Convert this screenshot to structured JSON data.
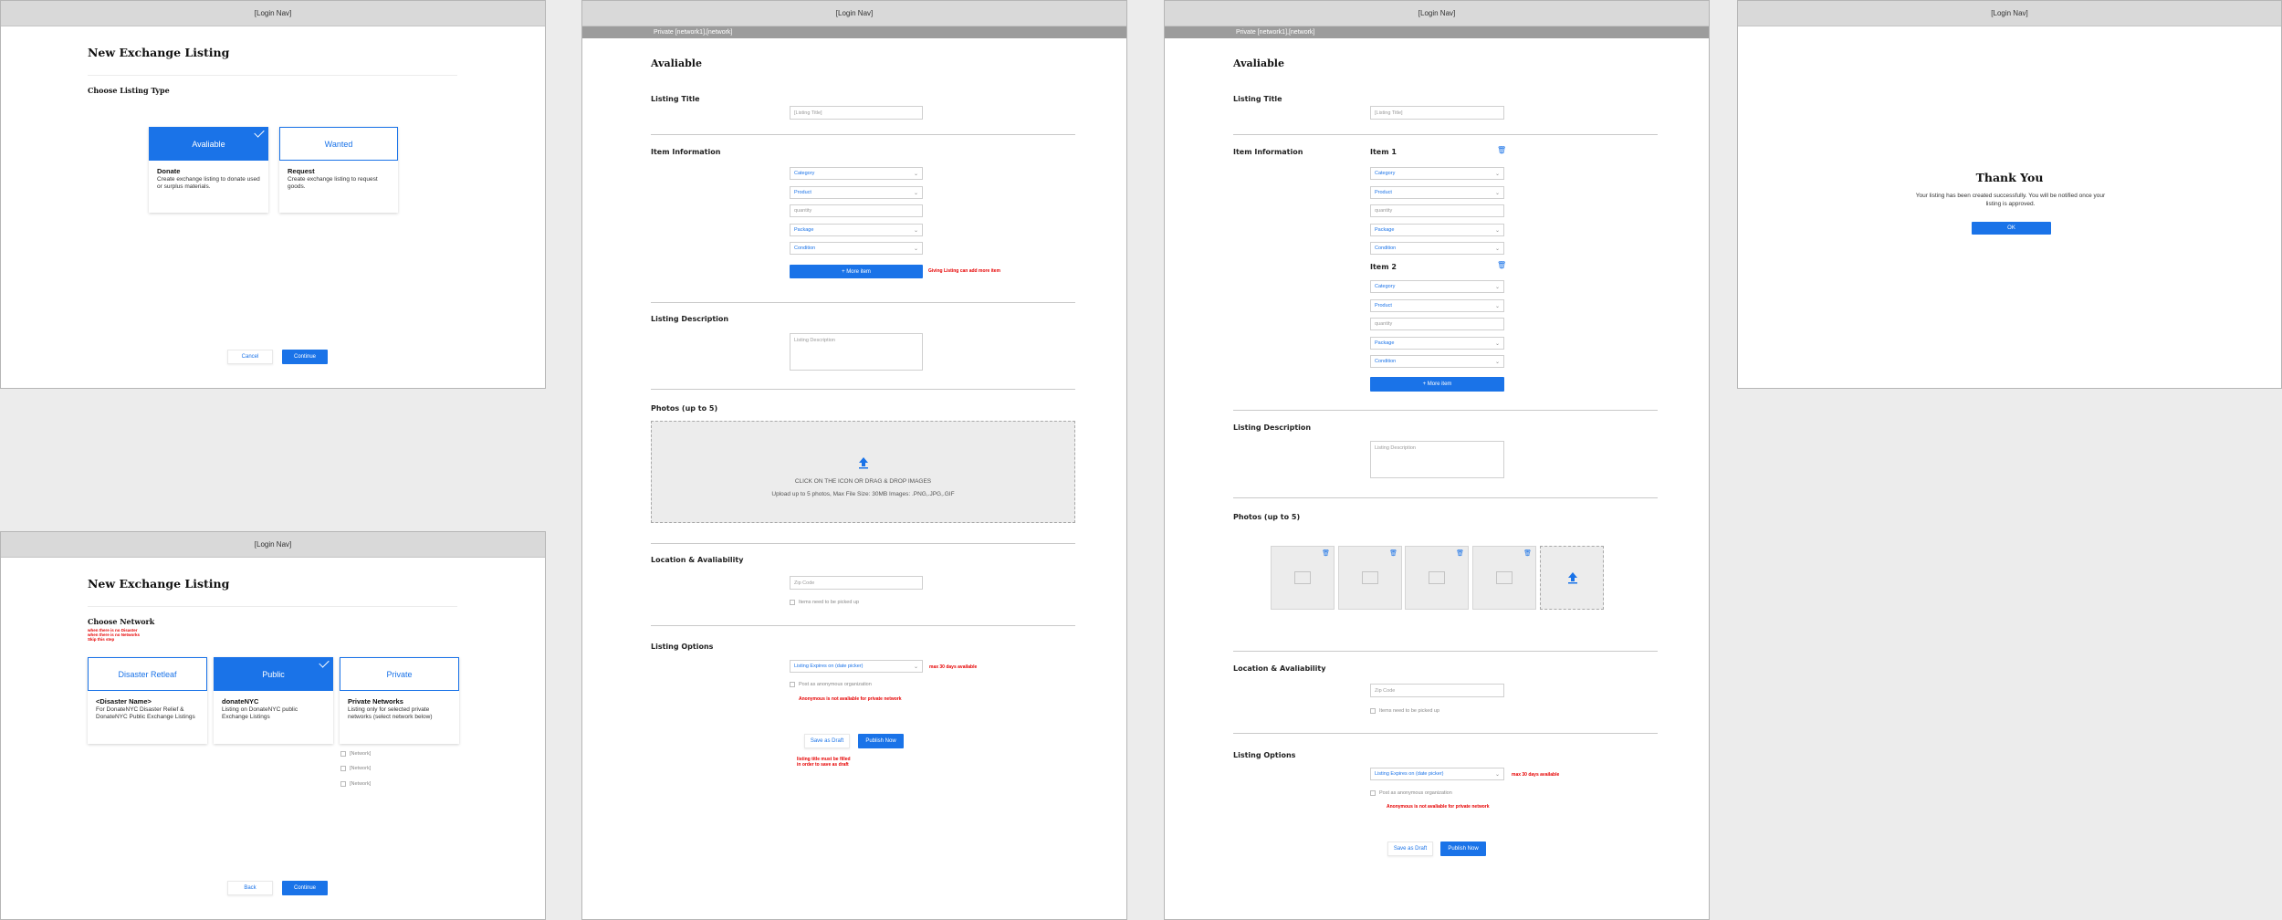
{
  "nav_label": "[Login Nav]",
  "subnav_label": "Private [network1],[network]",
  "f1": {
    "title": "New Exchange Listing",
    "subtitle": "Choose Listing Type",
    "cards": [
      {
        "head": "Avaliable",
        "title": "Donate",
        "desc": "Create exchange listing to donate used or surplus materials."
      },
      {
        "head": "Wanted",
        "title": "Request",
        "desc": "Create exchange listing to request goods."
      }
    ],
    "cancel": "Cancel",
    "continue": "Continue"
  },
  "f2": {
    "title": "New Exchange Listing",
    "subtitle": "Choose Network",
    "note": "when there is no Disaster\nwhen there is no Networks\nSkip this step",
    "cards": [
      {
        "head": "Disaster Retleaf",
        "title": "<Disaster Name>",
        "desc": "For DonateNYC Disaster Relief & DonateNYC Public Exchange Listings"
      },
      {
        "head": "Public",
        "title": "donateNYC",
        "desc": "Listing on DonateNYC public Exchange Listings"
      },
      {
        "head": "Private",
        "title": "Private Networks",
        "desc": "Listing only for selected private networks (select network below)"
      }
    ],
    "networks": [
      "[Network]",
      "[Network]",
      "[Network]"
    ],
    "back": "Back",
    "continue": "Continue"
  },
  "f3": {
    "title": "Avaliable",
    "listing_title_label": "Listing Title",
    "listing_title_ph": "[Listing Title]",
    "item_info_label": "Item Information",
    "category": "Category",
    "product": "Product",
    "quantity": "quantity",
    "package": "Package",
    "condition": "Condition",
    "more_item": "+ More item",
    "more_item_note": "Giving Listing can add more item",
    "desc_label": "Listing Description",
    "desc_ph": "Listing Description",
    "photos_label": "Photos (up to 5)",
    "drop_line1": "CLICK ON THE ICON OR DRAG & DROP IMAGES",
    "drop_line2": "Upload up to 5 photos, Max File Size: 30MB  Images: .PNG,.JPG,.GIF",
    "location_label": "Location & Avaliability",
    "zip_ph": "Zip Code",
    "pickup": "Items need to be picked up",
    "options_label": "Listing Options",
    "expires": "Listing Expires on (date picker)",
    "expires_note": "max 30 days available",
    "anon": "Post as anonymous organization",
    "anon_note": "Anonymous is not avaliable for private network",
    "save_draft": "Save as Draft",
    "publish": "Publish Now",
    "draft_note": "listing title must be filled\nin order to save as draft"
  },
  "f4": {
    "title": "Avaliable",
    "listing_title_label": "Listing Title",
    "listing_title_ph": "[Listing Title]",
    "item_info_label": "Item Information",
    "item1": "Item 1",
    "item2": "Item 2",
    "category": "Category",
    "product": "Product",
    "quantity": "quantity",
    "package": "Package",
    "condition": "Condition",
    "more_item": "+ More item",
    "desc_label": "Listing Description",
    "desc_ph": "Listing Description",
    "photos_label": "Photos (up to 5)",
    "location_label": "Location & Avaliability",
    "zip_ph": "Zip Code",
    "pickup": "Items need to be picked up",
    "options_label": "Listing Options",
    "expires": "Listing Expires on (date picker)",
    "expires_note": "max 30 days available",
    "anon": "Post as anonymous organization",
    "anon_note": "Anonymous is not avaliable for private network",
    "save_draft": "Save as Draft",
    "publish": "Publish Now"
  },
  "f5": {
    "title": "Thank You",
    "message": "Your listing has been created successfully. You will be notified once your listing is approved.",
    "ok": "OK"
  },
  "colors": {
    "accent": "#1a73e8",
    "error": "#e60000",
    "nav": "#d9d9d9",
    "subnav": "#9c9c9c"
  },
  "icons": [
    "check-icon",
    "chevron-down-icon",
    "upload-icon",
    "trash-icon",
    "image-placeholder-icon"
  ]
}
